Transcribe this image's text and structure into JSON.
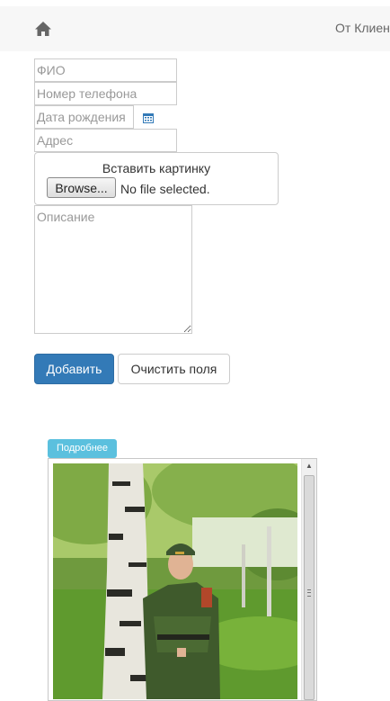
{
  "navbar": {
    "home_icon": "home-icon",
    "link_label": "От Клиен"
  },
  "form": {
    "fio_placeholder": "ФИО",
    "phone_placeholder": "Номер телефона",
    "birth_placeholder": "Дата рождения",
    "calendar_icon": "calendar-icon",
    "address_placeholder": "Адрес",
    "upload_label": "Вставить картинку",
    "browse_label": "Browse...",
    "file_status": "No file selected.",
    "description_placeholder": "Описание",
    "add_button_label": "Добавить",
    "clear_button_label": "Очистить поля"
  },
  "card": {
    "details_badge": "Подробнее"
  },
  "colors": {
    "primary": "#337ab7",
    "info": "#5bc0de",
    "navbar_bg": "#f7f7f7"
  }
}
